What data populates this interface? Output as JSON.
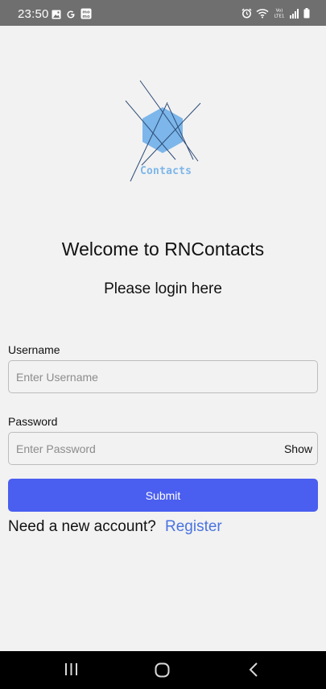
{
  "status_bar": {
    "time": "23:50",
    "left_icons": [
      "gallery-icon",
      "google-icon",
      "momo-icon"
    ],
    "momo_label": "mo mo",
    "network_label": "Vo) LTE1",
    "right_icons": [
      "alarm-icon",
      "wifi-icon",
      "volte-lte-icon",
      "signal-icon",
      "battery-icon"
    ]
  },
  "logo": {
    "text": "Contacts",
    "colors": {
      "hex": "#7cb6ea",
      "lines": "#2f4d78"
    }
  },
  "welcome_title": "Welcome to RNContacts",
  "login_subtitle": "Please login here",
  "username": {
    "label": "Username",
    "placeholder": "Enter Username",
    "value": ""
  },
  "password": {
    "label": "Password",
    "placeholder": "Enter Password",
    "value": "",
    "toggle_label": "Show"
  },
  "submit_label": "Submit",
  "account_prompt": "Need a new account?",
  "register_label": "Register",
  "nav_bar": {
    "icons": [
      "recent-apps-icon",
      "home-icon",
      "back-icon"
    ]
  },
  "colors": {
    "primary": "#4a5ef0",
    "link": "#4a73e0",
    "background": "#f2f2f2",
    "status_bar": "#6f6f6f"
  }
}
